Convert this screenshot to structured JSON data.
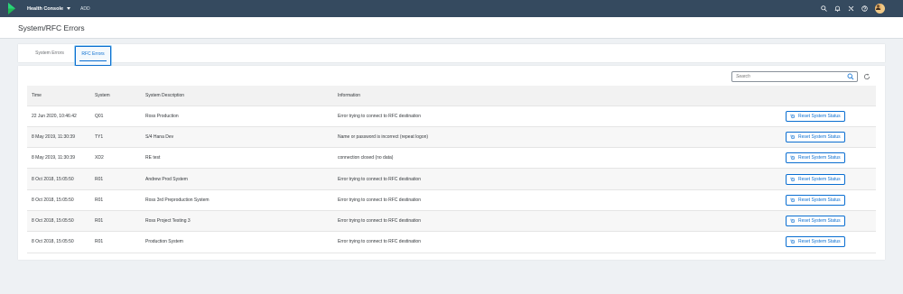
{
  "shell": {
    "app_title": "Health Console",
    "system_id": "ADD",
    "icons": [
      "logo-icon",
      "search-icon",
      "bell-icon",
      "tools-icon",
      "help-icon",
      "avatar"
    ]
  },
  "page": {
    "title": "System/RFC Errors"
  },
  "tabs": [
    {
      "label": "System Errors",
      "selected": false
    },
    {
      "label": "RFC Errors",
      "selected": true
    }
  ],
  "search": {
    "placeholder": "Search"
  },
  "table": {
    "columns": [
      "Time",
      "System",
      "System Description",
      "Information",
      ""
    ],
    "action_label": "Reset System Status",
    "rows": [
      {
        "time": "22 Jun 2020, 10:46:42",
        "system": "Q01",
        "description": "Ross Production",
        "information": "Error trying to connect to RFC destination"
      },
      {
        "time": "8 May 2019, 11:30:39",
        "system": "TY1",
        "description": "S/4 Hana Dev",
        "information": "Name or password is incorrect (repeat logon)"
      },
      {
        "time": "8 May 2019, 11:30:39",
        "system": "XD2",
        "description": "RE test",
        "information": "connection closed (no data)"
      },
      {
        "time": "8 Oct 2018, 15:05:50",
        "system": "R01",
        "description": "Andrew Prod System",
        "information": "Error trying to connect to RFC destination"
      },
      {
        "time": "8 Oct 2018, 15:05:50",
        "system": "R01",
        "description": "Ross 3rd Preproduction System",
        "information": "Error trying to connect to RFC destination"
      },
      {
        "time": "8 Oct 2018, 15:05:50",
        "system": "R01",
        "description": "Ross Project Testing 3",
        "information": "Error trying to connect to RFC destination"
      },
      {
        "time": "8 Oct 2018, 15:05:50",
        "system": "R01",
        "description": "Production System",
        "information": "Error trying to connect to RFC destination"
      }
    ]
  },
  "colors": {
    "shell": "#354a5f",
    "accent": "#0a6ed1",
    "logo": "#1db954"
  }
}
